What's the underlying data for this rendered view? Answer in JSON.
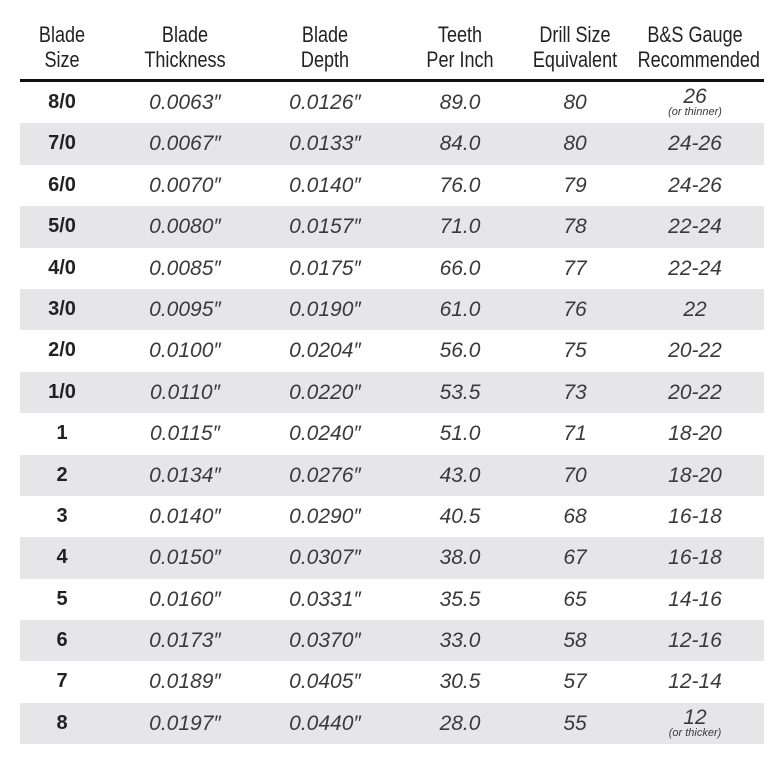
{
  "headers": [
    [
      "Blade",
      "Size"
    ],
    [
      "Blade",
      "Thickness"
    ],
    [
      "Blade",
      "Depth"
    ],
    [
      "Teeth",
      "Per Inch"
    ],
    [
      "Drill Size",
      "Equivalent"
    ],
    [
      "B&S Gauge",
      "Recommended"
    ]
  ],
  "rows": [
    {
      "size": "8/0",
      "thickness": "0.0063″",
      "depth": "0.0126″",
      "tpi": "89.0",
      "drill": "80",
      "gauge": "26",
      "note": "(or thinner)"
    },
    {
      "size": "7/0",
      "thickness": "0.0067″",
      "depth": "0.0133″",
      "tpi": "84.0",
      "drill": "80",
      "gauge": "24-26"
    },
    {
      "size": "6/0",
      "thickness": "0.0070″",
      "depth": "0.0140″",
      "tpi": "76.0",
      "drill": "79",
      "gauge": "24-26"
    },
    {
      "size": "5/0",
      "thickness": "0.0080″",
      "depth": "0.0157″",
      "tpi": "71.0",
      "drill": "78",
      "gauge": "22-24"
    },
    {
      "size": "4/0",
      "thickness": "0.0085″",
      "depth": "0.0175″",
      "tpi": "66.0",
      "drill": "77",
      "gauge": "22-24"
    },
    {
      "size": "3/0",
      "thickness": "0.0095″",
      "depth": "0.0190″",
      "tpi": "61.0",
      "drill": "76",
      "gauge": "22"
    },
    {
      "size": "2/0",
      "thickness": "0.0100″",
      "depth": "0.0204″",
      "tpi": "56.0",
      "drill": "75",
      "gauge": "20-22"
    },
    {
      "size": "1/0",
      "thickness": "0.0110″",
      "depth": "0.0220″",
      "tpi": "53.5",
      "drill": "73",
      "gauge": "20-22"
    },
    {
      "size": "1",
      "thickness": "0.0115″",
      "depth": "0.0240″",
      "tpi": "51.0",
      "drill": "71",
      "gauge": "18-20"
    },
    {
      "size": "2",
      "thickness": "0.0134″",
      "depth": "0.0276″",
      "tpi": "43.0",
      "drill": "70",
      "gauge": "18-20"
    },
    {
      "size": "3",
      "thickness": "0.0140″",
      "depth": "0.0290″",
      "tpi": "40.5",
      "drill": "68",
      "gauge": "16-18"
    },
    {
      "size": "4",
      "thickness": "0.0150″",
      "depth": "0.0307″",
      "tpi": "38.0",
      "drill": "67",
      "gauge": "16-18"
    },
    {
      "size": "5",
      "thickness": "0.0160″",
      "depth": "0.0331″",
      "tpi": "35.5",
      "drill": "65",
      "gauge": "14-16"
    },
    {
      "size": "6",
      "thickness": "0.0173″",
      "depth": "0.0370″",
      "tpi": "33.0",
      "drill": "58",
      "gauge": "12-16"
    },
    {
      "size": "7",
      "thickness": "0.0189″",
      "depth": "0.0405″",
      "tpi": "30.5",
      "drill": "57",
      "gauge": "12-14"
    },
    {
      "size": "8",
      "thickness": "0.0197″",
      "depth": "0.0440″",
      "tpi": "28.0",
      "drill": "55",
      "gauge": "12",
      "note": "(or thicker)"
    }
  ],
  "colors": {
    "stripe": "#e6e6e8",
    "rule": "#111111",
    "text": "#3a3a3a"
  }
}
